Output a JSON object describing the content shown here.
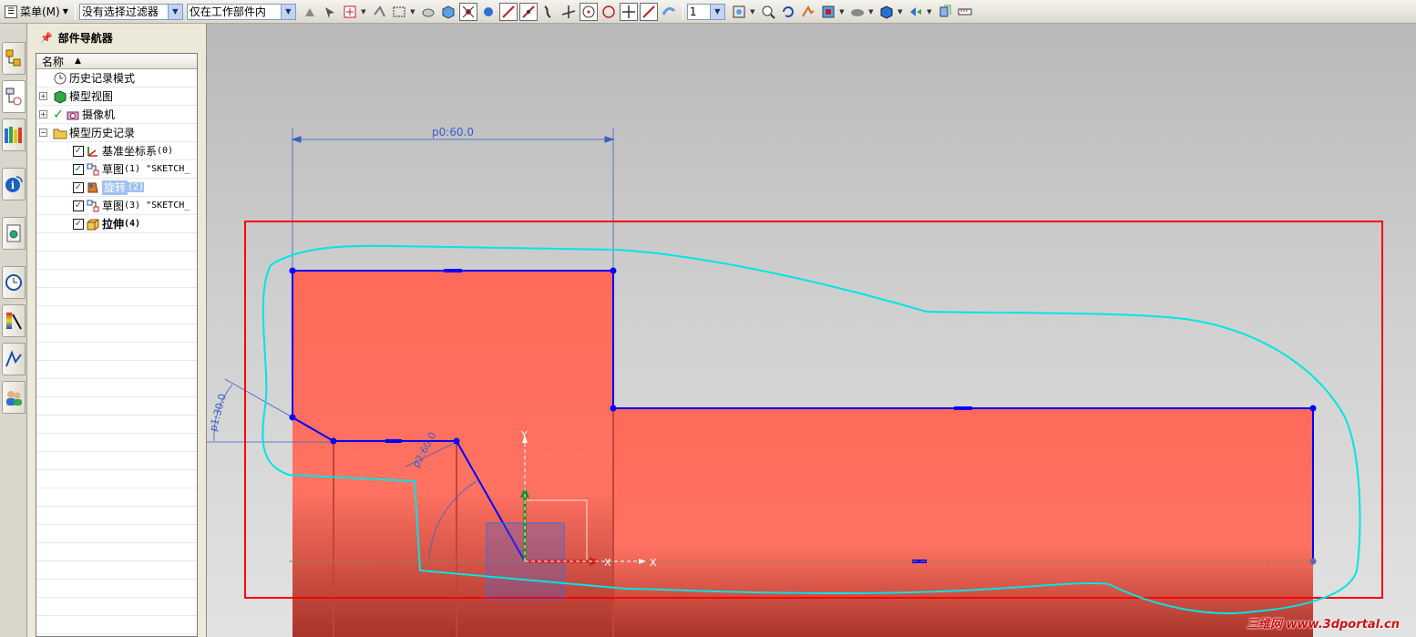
{
  "toolbar": {
    "menu_label": "菜单(M)",
    "selection_filter": "没有选择过滤器",
    "scope": "仅在工作部件内",
    "layer_value": "1",
    "icons": [
      "snap-icon",
      "select-icon",
      "feature-icon",
      "arrange-icon",
      "box-select-icon",
      "orient-icon",
      "shade-icon",
      "point-icon",
      "control-point-icon",
      "endpoint-icon",
      "midpoint-icon",
      "curve-icon",
      "intersect-icon",
      "center-icon",
      "quadrant-icon",
      "existing-point-icon",
      "point-on-curve-icon",
      "surface-point-icon",
      "fit-icon",
      "zoom-icon",
      "rotate-icon",
      "pan-icon",
      "view-icon",
      "render-icon",
      "shaded-icon",
      "perspective-icon",
      "layer-icon",
      "measure-icon"
    ]
  },
  "tabs": [
    "assembly-navigator",
    "part-navigator",
    "reuse-library",
    "hd3d-tools",
    "web-browser",
    "history",
    "system-materials",
    "process-studio",
    "roles"
  ],
  "navigator": {
    "title": "部件导航器",
    "column_name": "名称",
    "rows": [
      {
        "label": "历史记录模式",
        "icon": "clock-icon",
        "level": 1,
        "expander": "",
        "check": false,
        "selected": false,
        "bold": false,
        "mono": ""
      },
      {
        "label": "模型视图",
        "icon": "model-view-icon",
        "level": 1,
        "expander": "+",
        "check": false,
        "selected": false,
        "bold": false,
        "mono": ""
      },
      {
        "label": "摄像机",
        "icon": "camera-icon",
        "level": 1,
        "expander": "+",
        "check": true,
        "selected": false,
        "bold": false,
        "mono": ""
      },
      {
        "label": "模型历史记录",
        "icon": "folder-icon",
        "level": 1,
        "expander": "-",
        "check": false,
        "selected": false,
        "bold": false,
        "mono": ""
      },
      {
        "label": "基准坐标系",
        "icon": "datum-csys-icon",
        "level": 2,
        "expander": "",
        "check": true,
        "selected": false,
        "bold": false,
        "mono": " (0)"
      },
      {
        "label": "草图",
        "icon": "sketch-icon",
        "level": 2,
        "expander": "",
        "check": true,
        "selected": false,
        "bold": false,
        "mono": " (1) \"SKETCH_"
      },
      {
        "label": "旋转",
        "icon": "revolve-icon",
        "level": 2,
        "expander": "",
        "check": true,
        "selected": true,
        "bold": false,
        "mono": " (2)"
      },
      {
        "label": "草图",
        "icon": "sketch-icon",
        "level": 2,
        "expander": "",
        "check": true,
        "selected": false,
        "bold": false,
        "mono": " (3) \"SKETCH_"
      },
      {
        "label": "拉伸",
        "icon": "extrude-icon",
        "level": 2,
        "expander": "",
        "check": true,
        "selected": false,
        "bold": true,
        "mono": " (4)"
      }
    ]
  },
  "viewport": {
    "dim_horizontal": "p0:60.0",
    "dim_angle1": "p1:30.0",
    "dim_angle2": "p2:60.0",
    "axis_y": "Y",
    "axis_x": "X",
    "body_color": "#ff6a5a",
    "sketch_color": "#0000ff",
    "highlight_color": "#00e5e5",
    "frame_color": "#ff0000",
    "watermark": "三维网 www.3dportal.cn"
  }
}
